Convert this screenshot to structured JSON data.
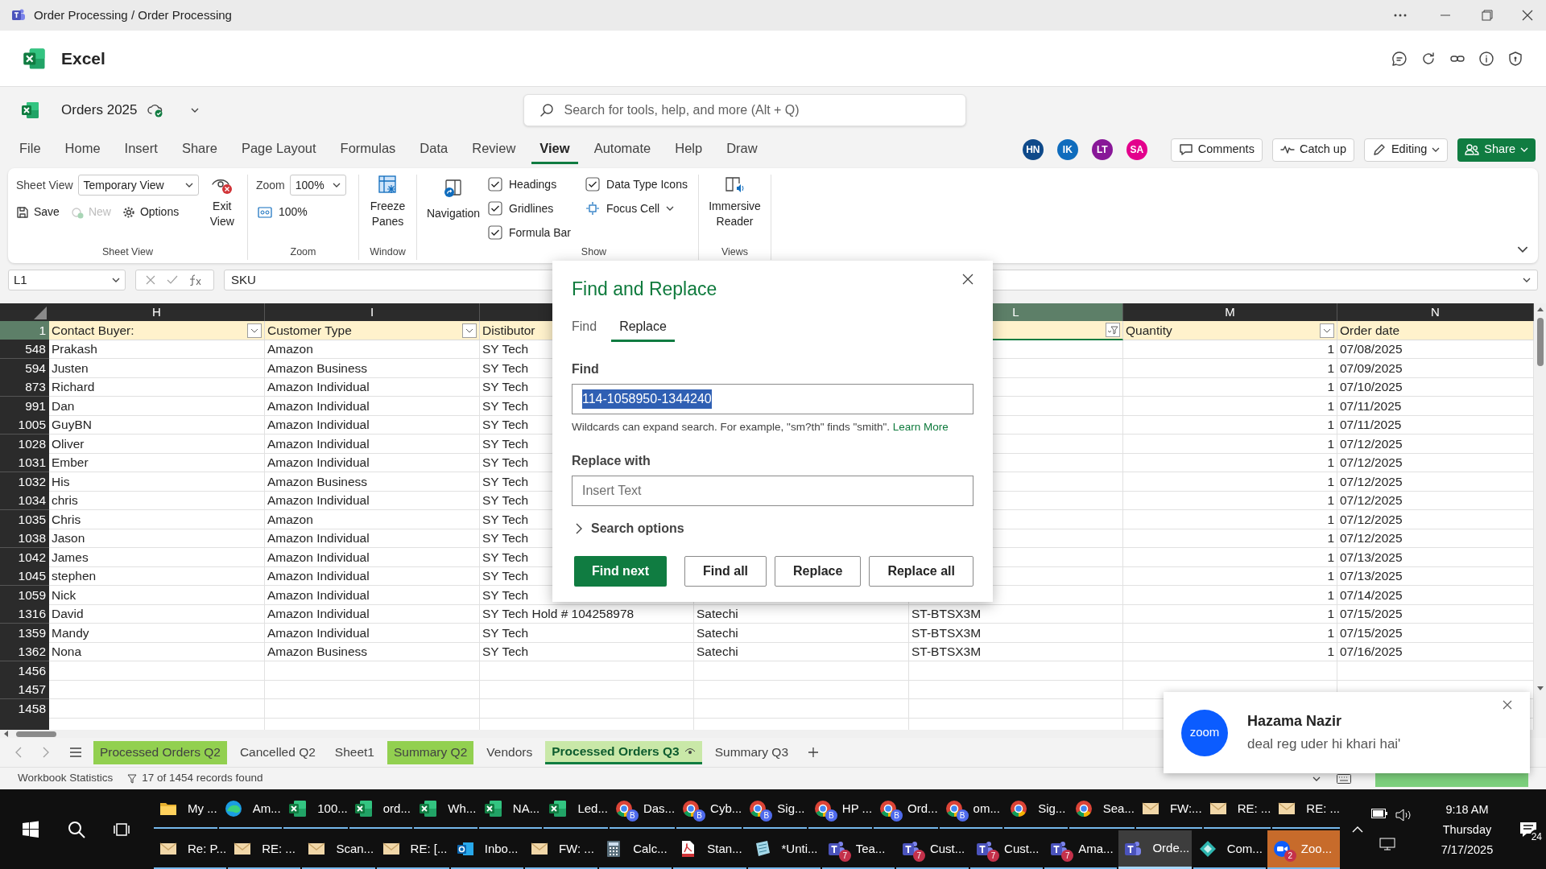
{
  "title_bar": {
    "title": "Order Processing / Order Processing"
  },
  "app_header": {
    "app_name": "Excel"
  },
  "document": {
    "name": "Orders 2025",
    "search_placeholder": "Search for tools, help, and more (Alt + Q)"
  },
  "menu_tabs": [
    {
      "label": "File",
      "selected": false
    },
    {
      "label": "Home",
      "selected": false
    },
    {
      "label": "Insert",
      "selected": false
    },
    {
      "label": "Share",
      "selected": false
    },
    {
      "label": "Page Layout",
      "selected": false
    },
    {
      "label": "Formulas",
      "selected": false
    },
    {
      "label": "Data",
      "selected": false
    },
    {
      "label": "Review",
      "selected": false
    },
    {
      "label": "View",
      "selected": true
    },
    {
      "label": "Automate",
      "selected": false
    },
    {
      "label": "Help",
      "selected": false
    },
    {
      "label": "Draw",
      "selected": false
    }
  ],
  "collaborators": [
    {
      "initials": "HN",
      "color": "#0f4a8a"
    },
    {
      "initials": "IK",
      "color": "#0f6cbd"
    },
    {
      "initials": "LT",
      "color": "#881798"
    },
    {
      "initials": "SA",
      "color": "#e3008c"
    }
  ],
  "actions": [
    {
      "label": "Comments",
      "kind": "comments"
    },
    {
      "label": "Catch up",
      "kind": "catchup"
    },
    {
      "label": "Editing",
      "kind": "editing"
    },
    {
      "label": "Share",
      "kind": "share"
    }
  ],
  "ribbon": {
    "sheet_view": {
      "label": "Sheet View",
      "view": "Temporary View",
      "save": "Save",
      "new": "New",
      "new_disabled": true,
      "options": "Options",
      "exit": "Exit View",
      "group_label": "Sheet View"
    },
    "zoom": {
      "label": "Zoom",
      "value": "100%",
      "reset": "100%",
      "group_label": "Zoom"
    },
    "window": {
      "button": "Freeze Panes",
      "group_label": "Window"
    },
    "navigation": "Navigation",
    "show": {
      "options": [
        {
          "label": "Headings",
          "kind": "checkbox",
          "checked": true
        },
        {
          "label": "Gridlines",
          "kind": "checkbox",
          "checked": true
        },
        {
          "label": "Formula Bar",
          "kind": "checkbox",
          "checked": true
        },
        {
          "label": "Data Type Icons",
          "kind": "checkbox",
          "checked": true
        },
        {
          "label": "Focus Cell",
          "kind": "dropdown"
        }
      ],
      "group_label": "Show"
    },
    "views": {
      "button": "Immersive Reader",
      "group_label": "Views"
    }
  },
  "formula_bar": {
    "name_box": "L1",
    "formula": "SKU"
  },
  "sheet": {
    "columns": [
      {
        "letter": "H",
        "selected": false
      },
      {
        "letter": "I",
        "selected": false
      },
      null,
      null,
      {
        "letter": "L",
        "selected": true
      },
      {
        "letter": "M",
        "selected": false
      },
      {
        "letter": "N",
        "selected": false
      }
    ],
    "header_row": {
      "number": "1",
      "cells": [
        {
          "text": "Contact Buyer:",
          "filter_button": true,
          "filtered": false
        },
        {
          "text": "Customer Type",
          "filter_button": true,
          "filtered": false
        },
        {
          "text": "Distibutor"
        },
        null,
        {
          "filter_button": true,
          "filtered": true
        },
        {
          "text": "Quantity",
          "filter_button": true,
          "filtered": false
        },
        {
          "text": "Order date"
        }
      ]
    },
    "rows": [
      {
        "number": "548",
        "cells": [
          "Prakash",
          "Amazon",
          "SY Tech",
          null,
          null,
          "1",
          "07/08/2025"
        ]
      },
      {
        "number": "594",
        "cells": [
          "Justen",
          "Amazon Business",
          "SY Tech",
          null,
          null,
          "1",
          "07/09/2025"
        ]
      },
      {
        "number": "873",
        "cells": [
          "Richard",
          "Amazon Individual",
          "SY Tech",
          null,
          null,
          "1",
          "07/10/2025"
        ]
      },
      {
        "number": "991",
        "cells": [
          "Dan",
          "Amazon Individual",
          "SY Tech",
          null,
          null,
          "1",
          "07/11/2025"
        ]
      },
      {
        "number": "1005",
        "cells": [
          "GuyBN",
          "Amazon Individual",
          "SY Tech",
          null,
          null,
          "1",
          "07/11/2025"
        ]
      },
      {
        "number": "1028",
        "cells": [
          "Oliver",
          "Amazon Individual",
          "SY Tech",
          null,
          null,
          "1",
          "07/12/2025"
        ]
      },
      {
        "number": "1031",
        "cells": [
          "Ember",
          "Amazon Individual",
          "SY Tech",
          null,
          null,
          "1",
          "07/12/2025"
        ]
      },
      {
        "number": "1032",
        "cells": [
          "His",
          "Amazon Business",
          "SY Tech",
          null,
          null,
          "1",
          "07/12/2025"
        ]
      },
      {
        "number": "1034",
        "cells": [
          "chris",
          "Amazon Individual",
          "SY Tech",
          null,
          null,
          "1",
          "07/12/2025"
        ]
      },
      {
        "number": "1035",
        "cells": [
          "Chris",
          "Amazon",
          "SY Tech",
          null,
          null,
          "1",
          "07/12/2025"
        ]
      },
      {
        "number": "1038",
        "cells": [
          "Jason",
          "Amazon Individual",
          "SY Tech",
          null,
          null,
          "1",
          "07/12/2025"
        ]
      },
      {
        "number": "1042",
        "cells": [
          "James",
          "Amazon Individual",
          "SY Tech",
          null,
          null,
          "1",
          "07/13/2025"
        ]
      },
      {
        "number": "1045",
        "cells": [
          "stephen",
          "Amazon Individual",
          "SY Tech",
          null,
          null,
          "1",
          "07/13/2025"
        ]
      },
      {
        "number": "1059",
        "cells": [
          "Nick",
          "Amazon Individual",
          "SY Tech",
          null,
          null,
          "1",
          "07/14/2025"
        ]
      },
      {
        "number": "1316",
        "cells": [
          "David",
          "Amazon Individual",
          "SY Tech Hold # 104258978",
          "Satechi",
          "ST-BTSX3M",
          "1",
          "07/15/2025"
        ]
      },
      {
        "number": "1359",
        "cells": [
          "Mandy",
          "Amazon Individual",
          "SY Tech",
          "Satechi",
          "ST-BTSX3M",
          "1",
          "07/15/2025"
        ]
      },
      {
        "number": "1362",
        "cells": [
          "Nona",
          "Amazon Business",
          "SY Tech",
          "Satechi",
          "ST-BTSX3M",
          "1",
          "07/16/2025"
        ]
      },
      {
        "number": "1456",
        "cells": [
          null,
          null,
          null,
          null,
          null,
          null,
          null
        ]
      },
      {
        "number": "1457",
        "cells": [
          null,
          null,
          null,
          null,
          null,
          null,
          null
        ]
      },
      {
        "number": "1458",
        "cells": [
          null,
          null,
          null,
          null,
          null,
          null,
          null
        ]
      }
    ]
  },
  "dialog": {
    "title": "Find and Replace",
    "tabs": [
      {
        "label": "Find",
        "selected": false
      },
      {
        "label": "Replace",
        "selected": true
      }
    ],
    "find_label": "Find",
    "find_value": "114-1058950-1344240",
    "find_value_highlighted": true,
    "hint": "Wildcards can expand search. For example, \"sm?th\" finds \"smith\".",
    "hint_link": "Learn More",
    "replace_label": "Replace with",
    "replace_placeholder": "Insert Text",
    "search_options": {
      "label": "Search options",
      "expanded": false
    },
    "buttons": [
      {
        "label": "Find next",
        "kind": "primary"
      },
      {
        "label": "Find all",
        "kind": "secondary"
      },
      {
        "label": "Replace",
        "kind": "secondary"
      },
      {
        "label": "Replace all",
        "kind": "secondary"
      }
    ]
  },
  "sheet_tabs": [
    {
      "label": "Processed Orders Q2",
      "color": "#92d050",
      "selected": false
    },
    {
      "label": "Cancelled Q2",
      "selected": false
    },
    {
      "label": "Sheet1",
      "selected": false
    },
    {
      "label": "Summary Q2",
      "color": "#92d050",
      "selected": false
    },
    {
      "label": "Vendors",
      "selected": false
    },
    {
      "label": "Processed Orders Q3",
      "color": "#c9e8a8",
      "selected": true
    },
    {
      "label": "Summary Q3",
      "selected": false
    }
  ],
  "status_bar": {
    "statistics": "Workbook Statistics",
    "records": "17 of 1454 records found"
  },
  "notification": {
    "logo": "zoom",
    "sender": "Hazama Nazir",
    "message": "deal reg uder hi khari hai'"
  },
  "taskbar": {
    "upper_row": [
      {
        "label": "My ...",
        "kind": "folder",
        "selected": false,
        "flashing": false
      },
      {
        "label": "Am...",
        "kind": "edge",
        "selected": false,
        "flashing": false
      },
      {
        "label": "100...",
        "kind": "excel",
        "selected": false,
        "flashing": false
      },
      {
        "label": "ord...",
        "kind": "excel",
        "selected": false,
        "flashing": false
      },
      {
        "label": "Wh...",
        "kind": "excel",
        "selected": false,
        "flashing": false
      },
      {
        "label": "NA...",
        "kind": "excel",
        "selected": false,
        "flashing": false
      },
      {
        "label": "Led...",
        "kind": "excel",
        "selected": false,
        "flashing": false
      },
      {
        "label": "Das...",
        "kind": "chrome",
        "badge": "B",
        "selected": false,
        "flashing": false
      },
      {
        "label": "Cyb...",
        "kind": "chrome",
        "badge": "B",
        "selected": false,
        "flashing": false
      },
      {
        "label": "Sig...",
        "kind": "chrome",
        "badge": "B",
        "selected": false,
        "flashing": false
      },
      {
        "label": "HP ...",
        "kind": "chrome",
        "badge": "B",
        "selected": false,
        "flashing": false
      },
      {
        "label": "Ord...",
        "kind": "chrome",
        "badge": "B",
        "selected": false,
        "flashing": false
      },
      {
        "label": "om...",
        "kind": "chrome",
        "badge": "B",
        "selected": false,
        "flashing": false
      },
      {
        "label": "Sig...",
        "kind": "chrome",
        "selected": false,
        "flashing": false
      },
      {
        "label": "Sea...",
        "kind": "chrome",
        "selected": false,
        "flashing": false
      },
      {
        "label": "FW:...",
        "kind": "mail",
        "selected": false,
        "flashing": false
      },
      {
        "label": "RE: ...",
        "kind": "mail",
        "selected": false,
        "flashing": false
      },
      {
        "label": "RE: ...",
        "kind": "mail",
        "selected": false,
        "flashing": false
      }
    ],
    "lower_row": [
      {
        "label": "Re: P...",
        "kind": "mail",
        "selected": false,
        "flashing": false
      },
      {
        "label": "RE: ...",
        "kind": "mail",
        "selected": false,
        "flashing": false
      },
      {
        "label": "Scan...",
        "kind": "mail",
        "selected": false,
        "flashing": false
      },
      {
        "label": "RE: [...",
        "kind": "mail",
        "selected": false,
        "flashing": false
      },
      {
        "label": "Inbo...",
        "kind": "outlook",
        "selected": false,
        "flashing": false
      },
      {
        "label": "FW: ...",
        "kind": "mail",
        "selected": false,
        "flashing": false
      },
      {
        "label": "Calc...",
        "kind": "calculator",
        "selected": false,
        "flashing": false
      },
      {
        "label": "Stan...",
        "kind": "pdf",
        "selected": false,
        "flashing": false
      },
      {
        "label": "*Unti...",
        "kind": "notepad",
        "selected": false,
        "flashing": false
      },
      {
        "label": "Tea...",
        "kind": "teams",
        "badge": "7",
        "selected": false,
        "flashing": false
      },
      {
        "label": "Cust...",
        "kind": "teams",
        "badge": "7",
        "selected": false,
        "flashing": false
      },
      {
        "label": "Cust...",
        "kind": "teams",
        "badge": "7",
        "selected": false,
        "flashing": false
      },
      {
        "label": "Ama...",
        "kind": "teams",
        "badge": "7",
        "selected": false,
        "flashing": false
      },
      {
        "label": "Orde...",
        "kind": "teams",
        "selected": true,
        "flashing": false
      },
      {
        "label": "Com...",
        "kind": "app",
        "selected": false,
        "flashing": false
      },
      {
        "label": "Zoo...",
        "kind": "zoom",
        "badge": "2",
        "selected": false,
        "flashing": true
      }
    ],
    "time": "9:18 AM",
    "day": "Thursday",
    "date": "7/17/2025",
    "notifications": "24"
  }
}
